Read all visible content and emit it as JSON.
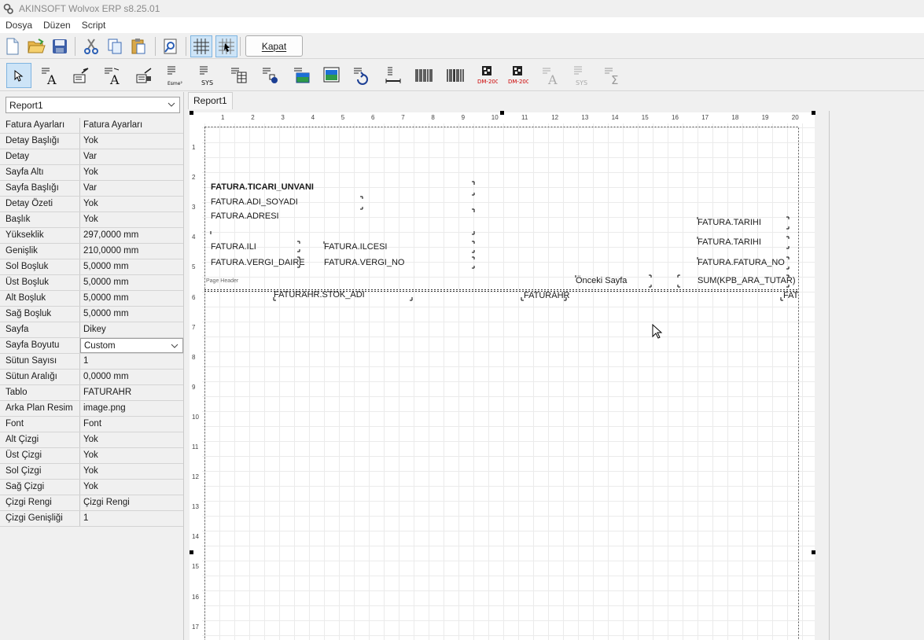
{
  "window": {
    "title": "AKINSOFT Wolvox ERP s8.25.01"
  },
  "menu": [
    "Dosya",
    "Düzen",
    "Script"
  ],
  "toolbar": {
    "icons": [
      "new-icon",
      "open-folder-icon",
      "save-icon",
      "cut-icon",
      "copy-icon",
      "paste-icon",
      "preview-icon",
      "grid-icon",
      "snap-grid-icon"
    ],
    "close_label": "Kapat"
  },
  "components_toolbar": {
    "icons": [
      "select-arrow-icon",
      "label-icon",
      "edit-label-icon",
      "memo-label-icon",
      "field-icon",
      "esme-icon",
      "sys-icon",
      "table-icon",
      "shape-icon",
      "image-icon",
      "dbimage-icon",
      "rotate-icon",
      "line-icon",
      "barcode-icon",
      "barcode2-icon",
      "datamatrix-icon",
      "datamatrix2-icon",
      "richtext-icon",
      "sysvar-icon",
      "sum-icon"
    ],
    "esme_label": "Esme²",
    "sys_label": "SYS",
    "dm_label": "DM-200"
  },
  "left_panel": {
    "report_select": "Report1",
    "properties": [
      {
        "name": "Fatura Ayarları",
        "value": "Fatura Ayarları"
      },
      {
        "name": "Detay Başlığı",
        "value": "Yok"
      },
      {
        "name": "Detay",
        "value": "Var"
      },
      {
        "name": "Sayfa Altı",
        "value": "Yok"
      },
      {
        "name": "Sayfa Başlığı",
        "value": "Var"
      },
      {
        "name": "Detay Özeti",
        "value": "Yok"
      },
      {
        "name": "Başlık",
        "value": "Yok"
      },
      {
        "name": "Yükseklik",
        "value": "297,0000 mm"
      },
      {
        "name": "Genişlik",
        "value": "210,0000 mm"
      },
      {
        "name": "Sol Boşluk",
        "value": "5,0000 mm"
      },
      {
        "name": "Üst Boşluk",
        "value": "5,0000 mm"
      },
      {
        "name": "Alt Boşluk",
        "value": "5,0000 mm"
      },
      {
        "name": "Sağ Boşluk",
        "value": "5,0000 mm"
      },
      {
        "name": "Sayfa",
        "value": "Dikey"
      },
      {
        "name": "Sayfa Boyutu",
        "value": "Custom"
      },
      {
        "name": "Sütun Sayısı",
        "value": "1"
      },
      {
        "name": "Sütun Aralığı",
        "value": "0,0000 mm"
      },
      {
        "name": "Tablo",
        "value": "FATURAHR"
      },
      {
        "name": "Arka Plan Resim",
        "value": "image.png"
      },
      {
        "name": "Font",
        "value": "Font"
      },
      {
        "name": "Alt Çizgi",
        "value": "Yok"
      },
      {
        "name": "Üst Çizgi",
        "value": "Yok"
      },
      {
        "name": "Sol Çizgi",
        "value": "Yok"
      },
      {
        "name": "Sağ Çizgi",
        "value": "Yok"
      },
      {
        "name": "Çizgi Rengi",
        "value": "Çizgi Rengi"
      },
      {
        "name": "Çizgi Genişliği",
        "value": "1"
      }
    ]
  },
  "designer": {
    "tab": "Report1",
    "ruler_top": [
      "1",
      "2",
      "3",
      "4",
      "5",
      "6",
      "7",
      "8",
      "9",
      "10",
      "11",
      "12",
      "13",
      "14",
      "15",
      "16",
      "17",
      "18",
      "19",
      "20"
    ],
    "ruler_left": [
      "1",
      "2",
      "3",
      "4",
      "5",
      "6",
      "7",
      "8",
      "9",
      "10",
      "11",
      "12",
      "13",
      "14",
      "15",
      "16",
      "17"
    ],
    "band_label": "Page Header",
    "fields": {
      "ticari_unvani": "FATURA.TICARI_UNVANI",
      "adi_soyadi": "FATURA.ADI_SOYADI",
      "adresi": "FATURA.ADRESI",
      "ili": "FATURA.ILI",
      "ilcesi": "FATURA.ILCESI",
      "vergi_daire": "FATURA.VERGI_DAIRE",
      "vergi_no": "FATURA.VERGI_NO",
      "tarihi1": "FATURA.TARIHI",
      "tarihi2": "FATURA.TARIHI",
      "fatura_no": "FATURA.FATURA_NO",
      "onceki_sayfa": "Önceki Sayfa",
      "sum": "SUM(KPB_ARA_TUTAR)",
      "stok_adi": "FATURAHR.STOK_ADI",
      "faturahr": "FATURAHR",
      "fat": "FAT"
    }
  }
}
